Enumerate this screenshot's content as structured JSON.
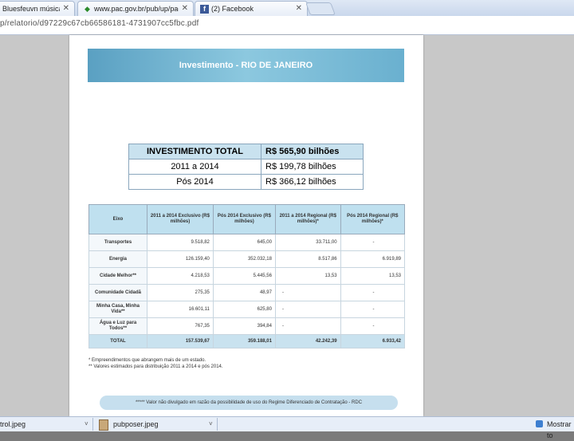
{
  "tabs": [
    {
      "label": "Bluesfeuvn música (",
      "icon": "music-note-icon"
    },
    {
      "label": "www.pac.gov.br/pub/up/pac",
      "icon": "brazil-flag-icon"
    },
    {
      "label": "(2) Facebook",
      "icon": "facebook-icon"
    }
  ],
  "address": "p/relatorio/d97229c67cb66586181-4731907cc5fbc.pdf",
  "pdf": {
    "banner_title": "Investimento - RIO DE JANEIRO",
    "investment_total": {
      "header_label": "INVESTIMENTO TOTAL",
      "header_value": "R$ 565,90 bilhões",
      "rows": [
        {
          "label": "2011 a 2014",
          "value": "R$ 199,78 bilhões"
        },
        {
          "label": "Pós 2014",
          "value": "R$ 366,12 bilhões"
        }
      ]
    },
    "table": {
      "headers": [
        "Eixo",
        "2011 a 2014 Exclusivo (R$ milhões)",
        "Pós 2014 Exclusivo (R$ milhões)",
        "2011 a 2014 Regional (R$ milhões)*",
        "Pós 2014 Regional (R$ milhões)*"
      ],
      "rows": [
        [
          "Transportes",
          "9.518,82",
          "645,00",
          "33.711,00",
          "-"
        ],
        [
          "Energia",
          "126.159,40",
          "352.032,18",
          "8.517,86",
          "6.919,89"
        ],
        [
          "Cidade Melhor**",
          "4.218,53",
          "5.445,56",
          "13,53",
          "13,53"
        ],
        [
          "Comunidade Cidadã",
          "275,35",
          "48,97",
          "-",
          "-"
        ],
        [
          "Minha Casa, Minha Vida**",
          "16.601,11",
          "625,80",
          "-",
          "-"
        ],
        [
          "Água e Luz para Todos**",
          "767,35",
          "394,84",
          "-",
          "-"
        ]
      ],
      "total": [
        "TOTAL",
        "157.539,67",
        "359.188,01",
        "42.242,39",
        "6.933,42"
      ]
    },
    "footnotes": [
      "* Empreendimentos que abrangem mais de um estado.",
      "** Valores estimados para distribuição 2011 a 2014 e pós 2014."
    ],
    "note": "***** Valor não divulgado em razão da possibilidade de uso do Regime Diferenciado de Contratação - RDC"
  },
  "downloads": [
    {
      "label": "trol.jpeg",
      "icon": "image-file-icon"
    },
    {
      "label": "pubposer.jpeg",
      "icon": "image-file-icon"
    }
  ],
  "download_bar_right": "Mostrar to"
}
